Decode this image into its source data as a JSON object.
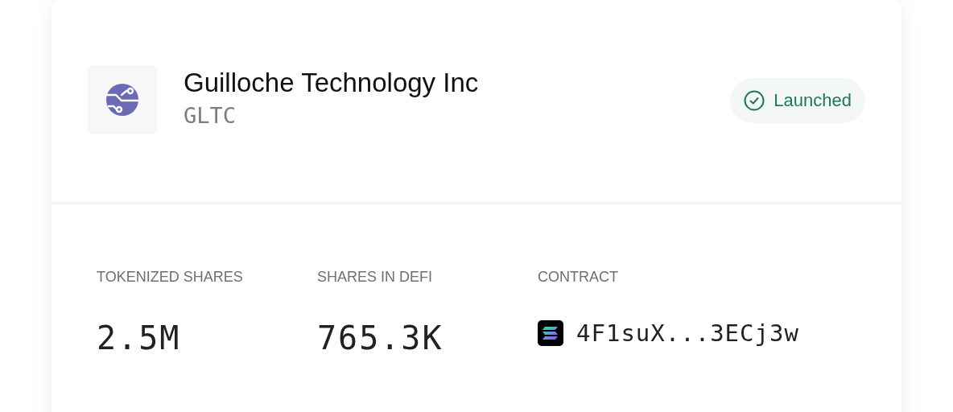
{
  "company": {
    "name": "Guilloche Technology Inc",
    "ticker": "GLTC"
  },
  "status": {
    "kind": "launched",
    "label": "Launched"
  },
  "stats": [
    {
      "label": "TOKENIZED SHARES",
      "value": "2.5M",
      "kind": "plain"
    },
    {
      "label": "SHARES IN DEFI",
      "value": "765.3K",
      "kind": "plain"
    },
    {
      "label": "CONTRACT",
      "value": "4F1suX...3ECj3w",
      "kind": "address"
    }
  ]
}
